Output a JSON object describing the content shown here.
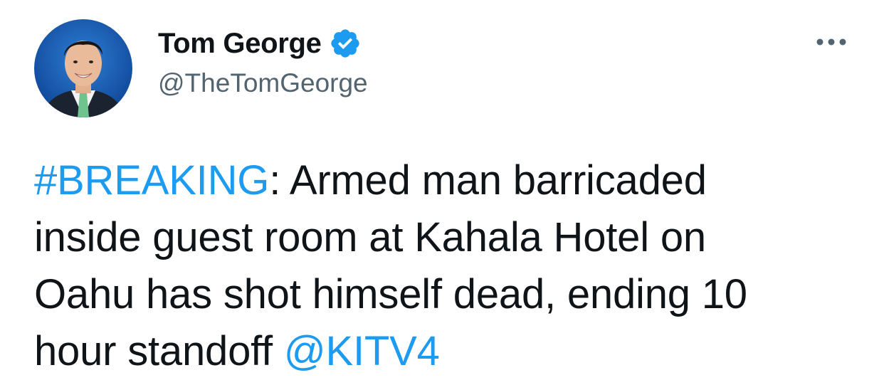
{
  "author": {
    "display_name": "Tom George",
    "handle": "@TheTomGeorge",
    "verified": true,
    "avatar_icon": "profile-photo"
  },
  "actions": {
    "more_icon": "more-options-icon"
  },
  "tweet": {
    "hashtag": "#BREAKING",
    "line1_rest": ": Armed man barricaded",
    "line2": "inside guest room at Kahala Hotel on",
    "line3": "Oahu has shot himself dead, ending 10",
    "line4_text": "hour standoff ",
    "mention": "@KITV4"
  },
  "colors": {
    "link": "#1d9bf0",
    "text": "#0f1419",
    "secondary": "#536471",
    "verified_badge": "#1d9bf0"
  }
}
